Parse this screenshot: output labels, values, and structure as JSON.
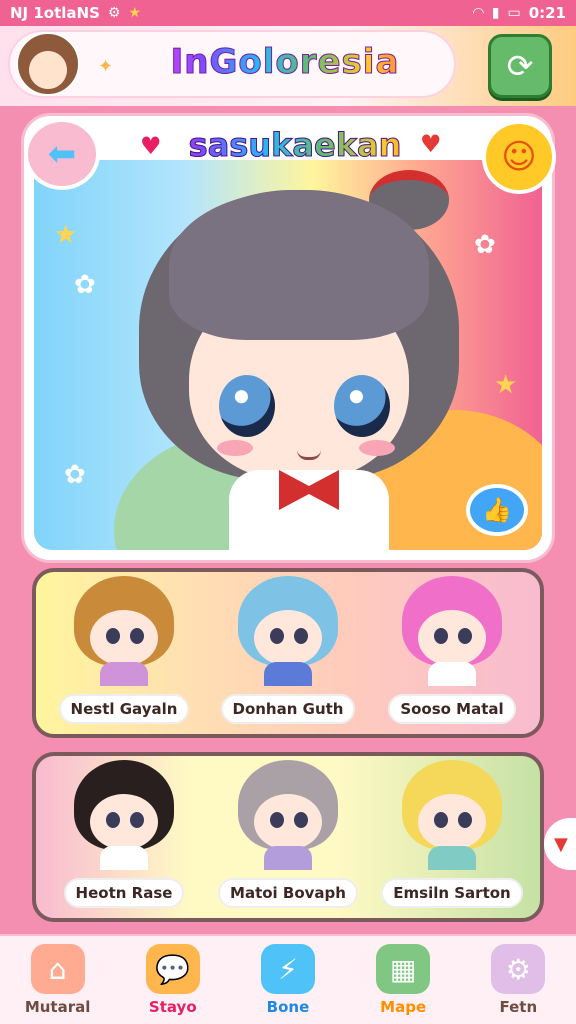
{
  "status_bar": {
    "left_text": "NJ 1otlaNS",
    "time": "0:21",
    "icons": [
      "settings-icon",
      "star-icon",
      "wifi-icon",
      "signal-icon",
      "battery-icon"
    ]
  },
  "header": {
    "app_title": "InGoloresia",
    "avatar": "user-avatar",
    "refresh_icon": "refresh-icon"
  },
  "hero": {
    "title": "sasukaekan",
    "back_icon": "back-arrow-icon",
    "mascot_icon": "mascot-icon",
    "like_icon": "thumbs-up-icon"
  },
  "characters_row1": [
    {
      "name": "Nestl Gayaln",
      "hair": "#c98a3a",
      "body": "#ce93d8"
    },
    {
      "name": "Donhan Guth",
      "hair": "#7ec3e6",
      "body": "#5c7bd8"
    },
    {
      "name": "Sooso Matal",
      "hair": "#f06fc8",
      "body": "#fff"
    }
  ],
  "characters_row2": [
    {
      "name": "Heotn Rase",
      "hair": "#2a1f1f",
      "body": "#fff"
    },
    {
      "name": "Matoi Bovaph",
      "hair": "#a9a1a6",
      "body": "#b39ddb"
    },
    {
      "name": "Emsiln Sarton",
      "hair": "#f5d75a",
      "body": "#80cbc4"
    }
  ],
  "bottom_nav": [
    {
      "label": "Mutaral",
      "icon": "home-icon",
      "color": "#ffab91",
      "label_color": "#6d4c41"
    },
    {
      "label": "Stayo",
      "icon": "chat-icon",
      "color": "#ffb74d",
      "label_color": "#e91e63"
    },
    {
      "label": "Bone",
      "icon": "lightning-icon",
      "color": "#4fc3f7",
      "label_color": "#1e88e5"
    },
    {
      "label": "Mape",
      "icon": "map-icon",
      "color": "#81c784",
      "label_color": "#ff8f00"
    },
    {
      "label": "Fetn",
      "icon": "gear-icon",
      "color": "#e1bee7",
      "label_color": "#6d4c41"
    }
  ],
  "colors": {
    "status_bar": "#f06292",
    "background": "#f48fb1",
    "panel_border": "#7b5a5e"
  }
}
